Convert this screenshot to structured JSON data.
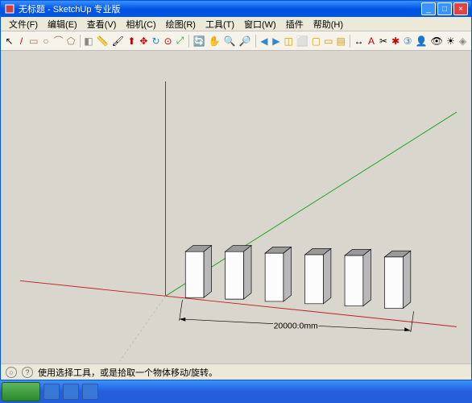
{
  "title": "无标题 - SketchUp 专业版",
  "menus": {
    "file": "文件(F)",
    "edit": "编辑(E)",
    "view": "查看(V)",
    "camera": "相机(C)",
    "draw": "绘图(R)",
    "tools": "工具(T)",
    "window": "窗口(W)",
    "plugins": "插件",
    "help": "帮助(H)"
  },
  "toolbar_icons": {
    "select": "↖",
    "line": "/",
    "rect": "▭",
    "circle": "○",
    "arc": "⌒",
    "poly": "⬠",
    "eraser": "◧",
    "tape": "📏",
    "paint": "🖌",
    "push": "⬆",
    "move": "✥",
    "rotate": "↻",
    "offset": "⊙",
    "scale": "⤢",
    "orbit": "🔄",
    "pan": "✋",
    "zoom": "🔍",
    "zoome": "🔎",
    "prev": "◀",
    "next": "▶",
    "iso": "◫",
    "top": "⬜",
    "front": "▢",
    "right": "▭",
    "back": "▤",
    "dim": "↔",
    "text": "A",
    "sect": "✂",
    "axes": "✱",
    "3d": "③",
    "walk": "👤",
    "look": "👁",
    "shad": "☀",
    "xray": "◈"
  },
  "dimension": "20000.0mm",
  "status": "使用选择工具，或是拾取一个物体移动/旋转。",
  "win_btns": {
    "min": "_",
    "max": "□",
    "close": "×"
  }
}
